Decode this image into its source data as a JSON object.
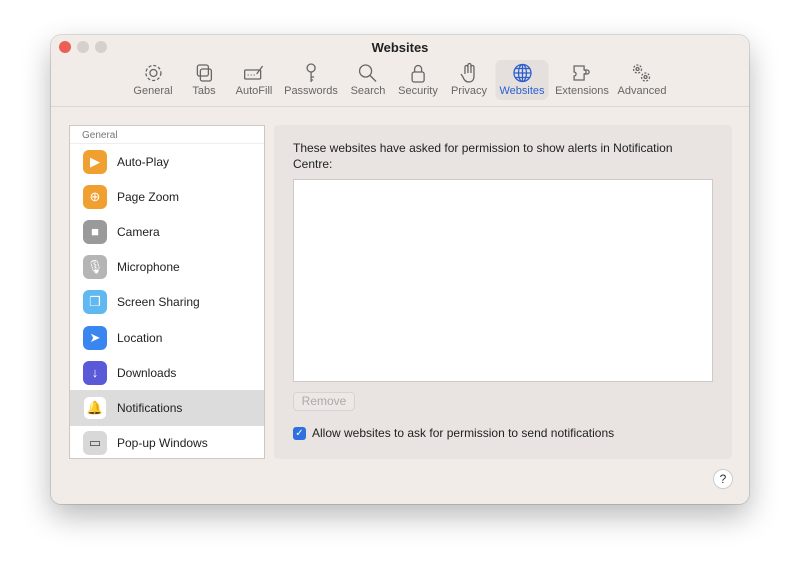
{
  "window": {
    "title": "Websites"
  },
  "toolbar": [
    {
      "label": "General",
      "icon": "gear-icon"
    },
    {
      "label": "Tabs",
      "icon": "tabs-icon"
    },
    {
      "label": "AutoFill",
      "icon": "autofill-icon"
    },
    {
      "label": "Passwords",
      "icon": "key-icon"
    },
    {
      "label": "Search",
      "icon": "search-icon"
    },
    {
      "label": "Security",
      "icon": "lock-icon"
    },
    {
      "label": "Privacy",
      "icon": "hand-icon"
    },
    {
      "label": "Websites",
      "icon": "globe-icon",
      "selected": true
    },
    {
      "label": "Extensions",
      "icon": "puzzle-icon"
    },
    {
      "label": "Advanced",
      "icon": "gears-icon"
    }
  ],
  "sidebar": {
    "header": "General",
    "items": [
      {
        "label": "Auto-Play",
        "icon": "play-icon",
        "color": "#f0a030"
      },
      {
        "label": "Page Zoom",
        "icon": "zoom-icon",
        "color": "#f0a030"
      },
      {
        "label": "Camera",
        "icon": "camera-icon",
        "color": "#9a9a9a"
      },
      {
        "label": "Microphone",
        "icon": "microphone-icon",
        "color": "#b5b5b5"
      },
      {
        "label": "Screen Sharing",
        "icon": "screen-sharing-icon",
        "color": "#5fb8f0"
      },
      {
        "label": "Location",
        "icon": "location-icon",
        "color": "#3a86f0"
      },
      {
        "label": "Downloads",
        "icon": "download-icon",
        "color": "#5a5ad8"
      },
      {
        "label": "Notifications",
        "icon": "bell-icon",
        "color": "#ffffff",
        "selected": true
      },
      {
        "label": "Pop-up Windows",
        "icon": "popup-icon",
        "color": "#d8d8d8"
      }
    ]
  },
  "panel": {
    "message": "These websites have asked for permission to show alerts in Notification Centre:",
    "remove_label": "Remove",
    "checkbox_label": "Allow websites to ask for permission to send notifications",
    "checkbox_checked": true
  },
  "help_label": "?",
  "accent": "#2a5fd0"
}
